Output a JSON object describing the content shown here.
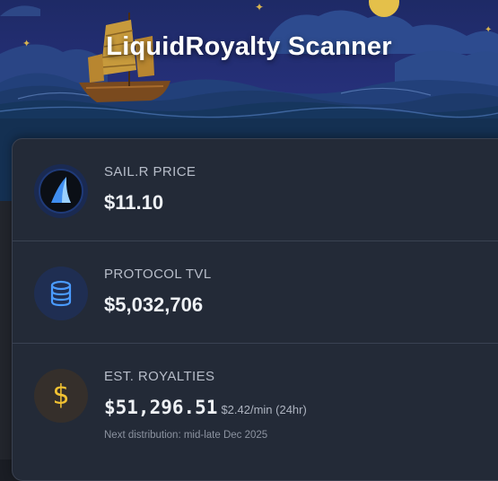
{
  "header": {
    "title": "LiquidRoyalty Scanner"
  },
  "colors": {
    "accent_blue": "#4a9bff",
    "gold": "#f2c232",
    "card_bg": "#232a37"
  },
  "stats": [
    {
      "icon": "sail-logo-icon",
      "label": "SAIL.R PRICE",
      "value": "$11.10"
    },
    {
      "icon": "database-icon",
      "label": "PROTOCOL TVL",
      "value": "$5,032,706"
    },
    {
      "icon": "dollar-icon",
      "label": "EST. ROYALTIES",
      "value": "$51,296.51",
      "rate": "$2.42/min (24hr)",
      "note": "Next distribution: mid-late Dec 2025"
    }
  ]
}
